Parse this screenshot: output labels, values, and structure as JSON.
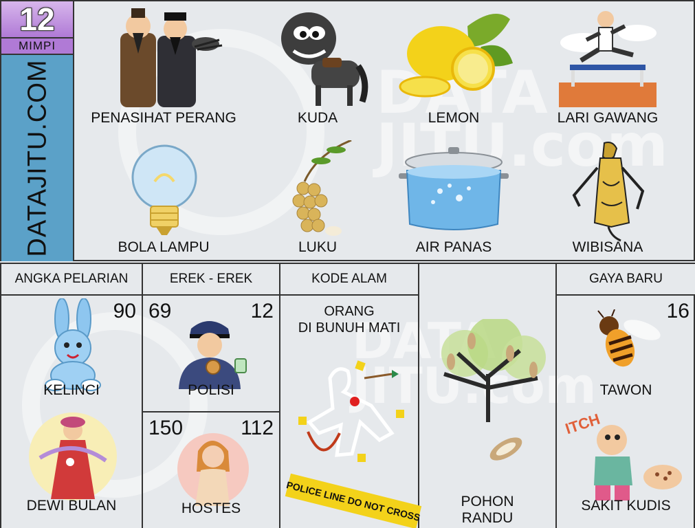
{
  "badge": {
    "number": "12",
    "label": "MIMPI"
  },
  "brand": {
    "vertical_text": "DATAJITU.COM"
  },
  "watermark": {
    "line1": "DATA",
    "line2": "JITU.com"
  },
  "dream_items": [
    {
      "label": "PENASIHAT PERANG",
      "icon": "two-advisors-icon"
    },
    {
      "label": "KUDA",
      "icon": "horse-icon"
    },
    {
      "label": "LEMON",
      "icon": "lemon-icon"
    },
    {
      "label": "LARI GAWANG",
      "icon": "hurdle-runner-icon"
    },
    {
      "label": "BOLA LAMPU",
      "icon": "light-bulb-icon"
    },
    {
      "label": "LUKU",
      "icon": "luku-fruit-icon"
    },
    {
      "label": "AIR PANAS",
      "icon": "boiling-pot-icon"
    },
    {
      "label": "WIBISANA",
      "icon": "wayang-puppet-icon"
    }
  ],
  "columns": {
    "angka_pelarian": "ANGKA PELARIAN",
    "erek_erek": "EREK - EREK",
    "kode_alam": "KODE ALAM",
    "gaya_baru": "GAYA BARU"
  },
  "angka_pelarian": {
    "number": "90",
    "item1": "KELINCI",
    "item2": "DEWI BULAN"
  },
  "erek": {
    "top_left": "69",
    "top_right": "12",
    "top_label": "POLISI",
    "bottom_left": "150",
    "bottom_right": "112",
    "bottom_label": "HOSTES"
  },
  "kode_alam": {
    "line1": "ORANG",
    "line2": "DI BUNUH MATI",
    "tape_text": "POLICE LINE DO NOT CROSS"
  },
  "pohon": {
    "line1": "POHON",
    "line2": "RANDU"
  },
  "gaya_baru": {
    "number": "16",
    "item1": "TAWON",
    "item2": "SAKIT KUDIS",
    "itch_text": "ITCH"
  },
  "colors": {
    "badge_purple": "#b07ad6",
    "brand_blue": "#5ba1c8",
    "background": "#e6e9ec",
    "border": "#333333"
  }
}
